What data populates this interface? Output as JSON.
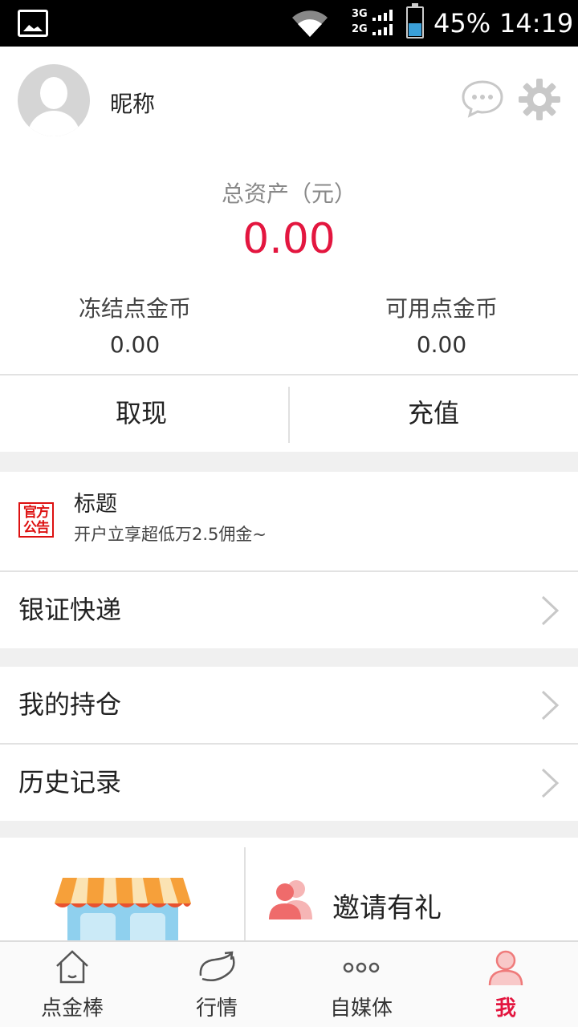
{
  "status_bar": {
    "network_top": "3G",
    "network_bottom": "2G",
    "battery": "45%",
    "time": "14:19"
  },
  "profile": {
    "nickname": "昵称",
    "total_assets_label": "总资产（元）",
    "total_assets_value": "0.00",
    "frozen_label": "冻结点金币",
    "frozen_value": "0.00",
    "available_label": "可用点金币",
    "available_value": "0.00"
  },
  "actions": {
    "withdraw": "取现",
    "recharge": "充值"
  },
  "notice": {
    "badge_line1": "官方",
    "badge_line2": "公告",
    "title": "标题",
    "subtitle": "开户立享超低万2.5佣金~"
  },
  "menu": {
    "bank_securities": "银证快递",
    "positions": "我的持仓",
    "history": "历史记录"
  },
  "promo": {
    "invite": "邀请有礼"
  },
  "tabs": [
    {
      "label": "点金棒",
      "icon": "home-icon"
    },
    {
      "label": "行情",
      "icon": "market-icon"
    },
    {
      "label": "自媒体",
      "icon": "media-icon"
    },
    {
      "label": "我",
      "icon": "user-icon"
    }
  ],
  "colors": {
    "accent": "#e3163f"
  }
}
